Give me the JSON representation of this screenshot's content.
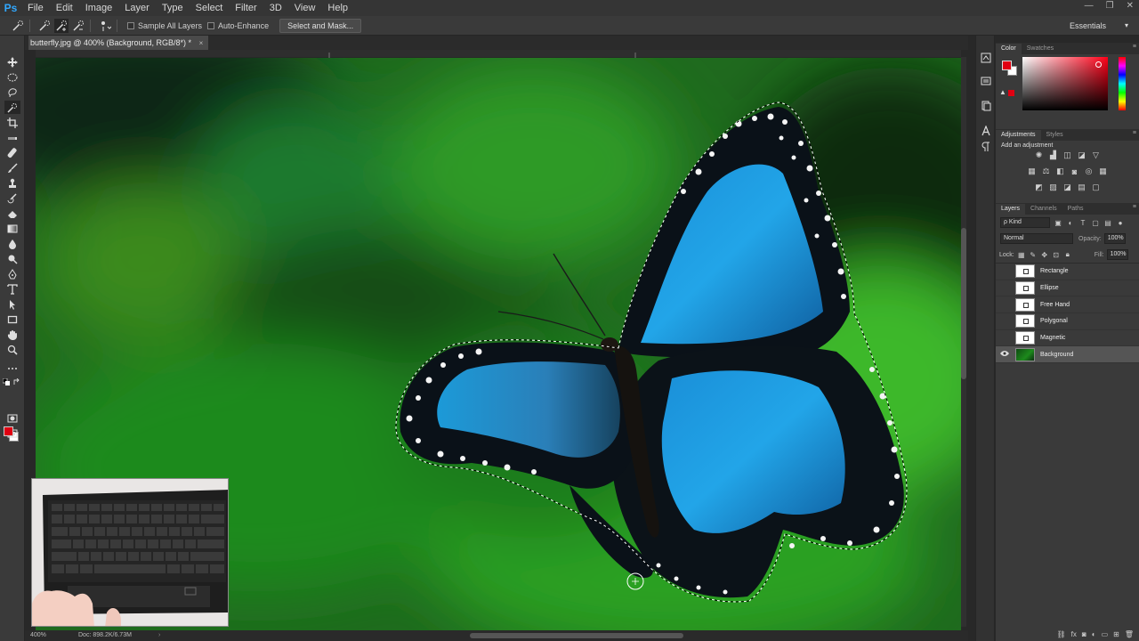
{
  "app": {
    "logo": "Ps"
  },
  "menu": [
    "File",
    "Edit",
    "Image",
    "Layer",
    "Type",
    "Select",
    "Filter",
    "3D",
    "View",
    "Help"
  ],
  "window_controls": [
    "—",
    "❐",
    "✕"
  ],
  "options_bar": {
    "sample_all_layers": "Sample All Layers",
    "auto_enhance": "Auto-Enhance",
    "select_and_mask": "Select and Mask...",
    "workspace": "Essentials"
  },
  "document": {
    "tab_title": "butterfly.jpg @ 400% (Background, RGB/8*) *",
    "close_glyph": "×"
  },
  "status": {
    "zoom": "400%",
    "doc_size": "Doc: 898.2K/6.73M",
    "arrow": "›"
  },
  "panels": {
    "color": {
      "tabs": [
        "Color",
        "Swatches"
      ],
      "menu_glyph": "≡"
    },
    "adjustments": {
      "tabs": [
        "Adjustments",
        "Styles"
      ],
      "title": "Add an adjustment",
      "menu_glyph": "≡"
    },
    "layers": {
      "tabs": [
        "Layers",
        "Channels",
        "Paths"
      ],
      "menu_glyph": "≡",
      "filter_kind": "ρ Kind",
      "blend_mode": "Normal",
      "opacity_label": "Opacity:",
      "opacity_value": "100%",
      "lock_label": "Lock:",
      "fill_label": "Fill:",
      "fill_value": "100%",
      "items": [
        {
          "name": "Rectangle",
          "visible": false,
          "selected": false
        },
        {
          "name": "Ellipse",
          "visible": false,
          "selected": false
        },
        {
          "name": "Free Hand",
          "visible": false,
          "selected": false
        },
        {
          "name": "Polygonal",
          "visible": false,
          "selected": false
        },
        {
          "name": "Magnetic",
          "visible": false,
          "selected": false
        },
        {
          "name": "Background",
          "visible": true,
          "selected": true
        }
      ]
    }
  },
  "colors": {
    "foreground": "#e00012",
    "background": "#ffffff",
    "accent": "#31a8ff"
  }
}
